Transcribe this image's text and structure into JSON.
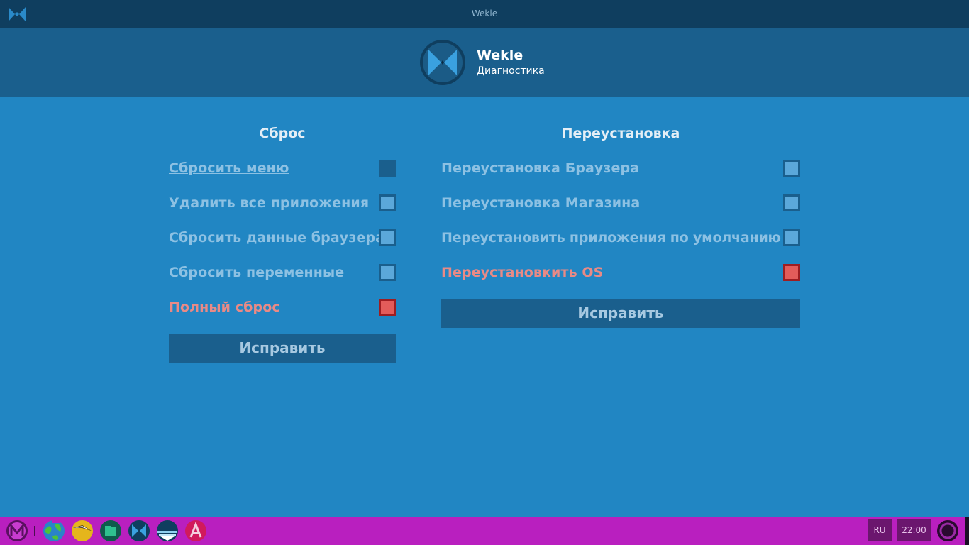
{
  "window": {
    "title": "Wekle"
  },
  "header": {
    "app_name": "Wekle",
    "subtitle": "Диагностика"
  },
  "reset": {
    "title": "Сброс",
    "options": [
      {
        "label": "Сбросить меню",
        "checked": false,
        "state": "link"
      },
      {
        "label": "Удалить все приложения",
        "checked": false,
        "state": "normal"
      },
      {
        "label": "Сбросить данные браузера",
        "checked": false,
        "state": "normal"
      },
      {
        "label": "Сбросить переменные",
        "checked": false,
        "state": "normal"
      },
      {
        "label": "Полный сброс",
        "checked": false,
        "state": "danger"
      }
    ],
    "button": "Исправить"
  },
  "reinstall": {
    "title": "Переустановка",
    "options": [
      {
        "label": "Переустановка Браузера",
        "checked": false,
        "state": "normal"
      },
      {
        "label": "Переустановка Магазина",
        "checked": false,
        "state": "normal"
      },
      {
        "label": "Переустановить приложения по умолчанию",
        "checked": false,
        "state": "normal"
      },
      {
        "label": "Переустановкить OS",
        "checked": false,
        "state": "danger"
      }
    ],
    "button": "Исправить"
  },
  "taskbar": {
    "apps": [
      "menu-icon",
      "browser-icon",
      "files-icon",
      "store-icon",
      "wekle-icon",
      "weather-icon",
      "fonts-icon"
    ],
    "language": "RU",
    "clock": "22:00"
  },
  "colors": {
    "background": "#2186c3",
    "header": "#1a5f8d",
    "titlebar": "#0f3e5f",
    "taskbar": "#b91fbf",
    "danger": "#e35c5a"
  }
}
